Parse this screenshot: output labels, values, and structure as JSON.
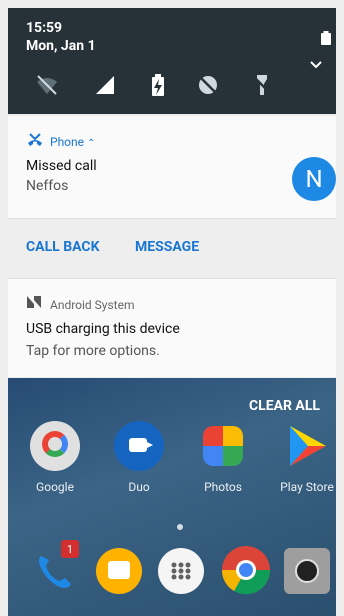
{
  "status": {
    "time": "15:59",
    "date": "Mon, Jan 1"
  },
  "quick_settings": [
    {
      "icon": "wifi-off-icon"
    },
    {
      "icon": "cell-signal-icon"
    },
    {
      "icon": "battery-charging-icon"
    },
    {
      "icon": "sync-off-icon"
    },
    {
      "icon": "flashlight-off-icon"
    }
  ],
  "notification_phone": {
    "app": "Phone",
    "title": "Missed call",
    "text": "Neffos",
    "avatar_letter": "N",
    "actions": {
      "call_back": "CALL BACK",
      "message": "MESSAGE"
    }
  },
  "notification_android": {
    "app": "Android System",
    "title": "USB charging this device",
    "text": "Tap for more options."
  },
  "home": {
    "clear_all": "CLEAR ALL",
    "apps": [
      {
        "label": "Google",
        "icon": "google-folder-icon"
      },
      {
        "label": "Duo",
        "icon": "duo-icon"
      },
      {
        "label": "Photos",
        "icon": "photos-icon"
      },
      {
        "label": "Play Store",
        "icon": "play-store-icon"
      }
    ],
    "dock": [
      {
        "icon": "phone-app-icon",
        "badge": "1"
      },
      {
        "icon": "messages-icon"
      },
      {
        "icon": "app-drawer-icon"
      },
      {
        "icon": "chrome-icon"
      },
      {
        "icon": "camera-icon"
      }
    ]
  },
  "colors": {
    "accent": "#1976d2",
    "avatar": "#1e88e5",
    "statusbar": "#263238"
  }
}
